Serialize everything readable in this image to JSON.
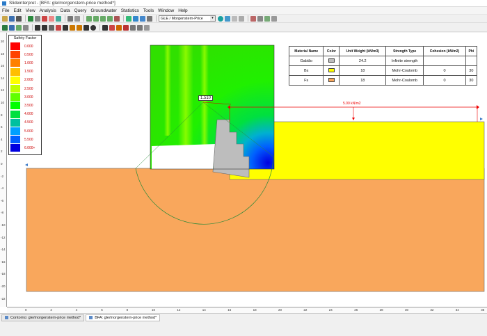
{
  "window": {
    "title": "Slideinterpret - [BFA: gle/morgenstern-price method*]"
  },
  "menu": [
    "File",
    "Edit",
    "View",
    "Analysis",
    "Data",
    "Query",
    "Groundwater",
    "Statistics",
    "Tools",
    "Window",
    "Help"
  ],
  "toolbar": {
    "method_combo": "GLE / Morgenstern-Price"
  },
  "legend": {
    "title": "Safety Factor",
    "items": [
      {
        "label": "0.000",
        "color": "#ff0000"
      },
      {
        "label": "0.500",
        "color": "#ff4000"
      },
      {
        "label": "1.000",
        "color": "#ff8000"
      },
      {
        "label": "1.500",
        "color": "#ffbf00"
      },
      {
        "label": "2.000",
        "color": "#ffff00"
      },
      {
        "label": "2.500",
        "color": "#bfff00"
      },
      {
        "label": "3.000",
        "color": "#60ff00"
      },
      {
        "label": "3.500",
        "color": "#00ff00"
      },
      {
        "label": "4.000",
        "color": "#00e040"
      },
      {
        "label": "4.500",
        "color": "#00c0a0"
      },
      {
        "label": "5.000",
        "color": "#00a0ff"
      },
      {
        "label": "5.500",
        "color": "#0060ff"
      },
      {
        "label": "6.000+",
        "color": "#0000e0"
      }
    ]
  },
  "materials": {
    "headers": [
      "Material Name",
      "Color",
      "Unit Weight (kN/m3)",
      "Strength Type",
      "Cohesion (kN/m2)",
      "Phi"
    ],
    "rows": [
      {
        "name": "Gabião",
        "color": "#bdbdbd",
        "unit_weight": "24.2",
        "strength": "Infinite strength",
        "cohesion": "",
        "phi": ""
      },
      {
        "name": "Bs",
        "color": "#ffff00",
        "unit_weight": "18",
        "strength": "Mohr-Coulomb",
        "cohesion": "0",
        "phi": "30"
      },
      {
        "name": "Fs",
        "color": "#f9a75c",
        "unit_weight": "18",
        "strength": "Mohr-Coulomb",
        "cohesion": "0",
        "phi": "30"
      }
    ]
  },
  "model": {
    "safety_factor": "1.510",
    "load_label": "5.00 kN/m2"
  },
  "axis": {
    "x_ticks": [
      "0",
      "2",
      "4",
      "6",
      "8",
      "10",
      "12",
      "14",
      "16",
      "18",
      "20",
      "22",
      "24",
      "26",
      "28",
      "30",
      "32",
      "34",
      "36"
    ],
    "y_ticks": [
      "20",
      "18",
      "16",
      "14",
      "12",
      "10",
      "8",
      "6",
      "4",
      "2",
      "0",
      "-2",
      "-4",
      "-6",
      "-8",
      "-10",
      "-12",
      "-14",
      "-16",
      "-18",
      "-20",
      "-22"
    ]
  },
  "tabs": [
    {
      "label": "Contorno: gle/morgenstern-price method*",
      "active": false
    },
    {
      "label": "BFA: gle/morgenstern-price method*",
      "active": true
    }
  ]
}
